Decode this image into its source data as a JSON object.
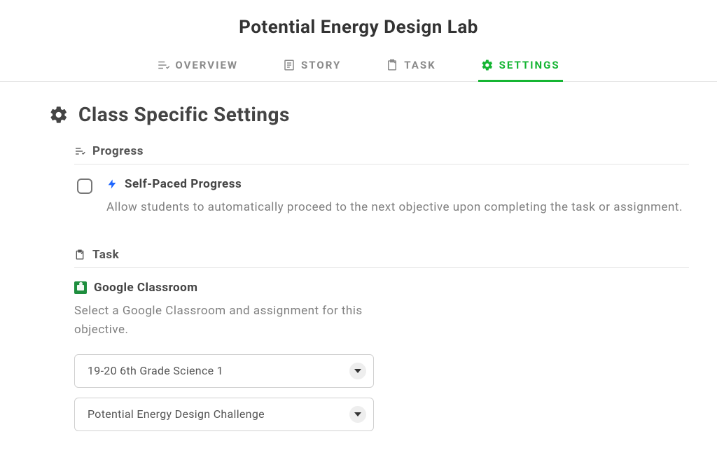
{
  "header": {
    "title": "Potential Energy Design Lab",
    "tabs": {
      "overview": "OVERVIEW",
      "story": "STORY",
      "task": "TASK",
      "settings": "SETTINGS"
    }
  },
  "settings": {
    "section_title": "Class Specific Settings",
    "progress": {
      "label": "Progress",
      "self_paced": {
        "title": "Self-Paced Progress",
        "desc": "Allow students to automatically proceed to the next objective upon completing the task or assignment.",
        "checked": false
      }
    },
    "task": {
      "label": "Task",
      "google_classroom": {
        "title": "Google Classroom",
        "desc": "Select a Google Classroom and assignment for this objective.",
        "class_select": "19-20 6th Grade Science 1",
        "assignment_select": "Potential Energy Design Challenge"
      }
    }
  }
}
